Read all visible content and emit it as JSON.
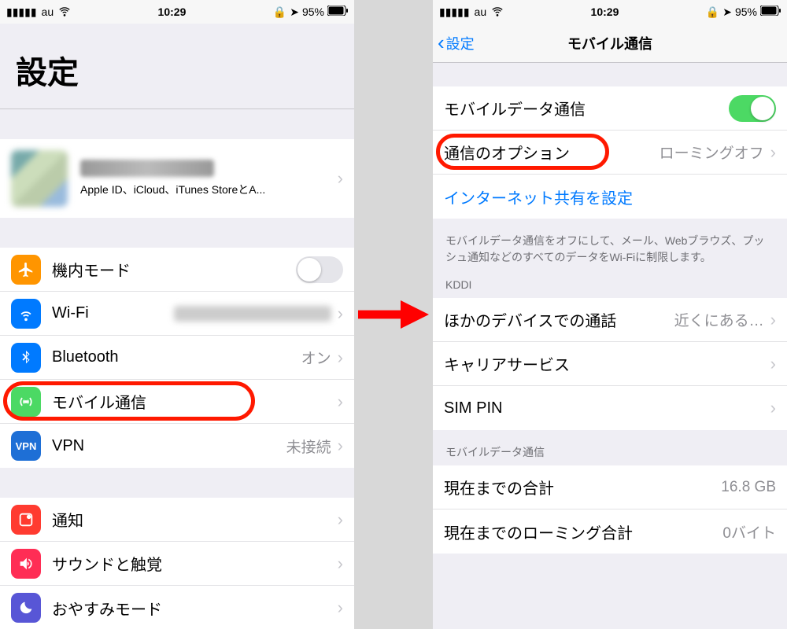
{
  "status": {
    "carrier": "au",
    "time": "10:29",
    "battery": "95%"
  },
  "left": {
    "title": "設定",
    "account_sub": "Apple ID、iCloud、iTunes StoreとA...",
    "rows": {
      "airplane": "機内モード",
      "wifi": "Wi-Fi",
      "bluetooth": "Bluetooth",
      "bt_value": "オン",
      "mobile": "モバイル通信",
      "vpn": "VPN",
      "vpn_value": "未接続",
      "notif": "通知",
      "sound": "サウンドと触覚",
      "dnd": "おやすみモード"
    }
  },
  "right": {
    "back": "設定",
    "title": "モバイル通信",
    "rows": {
      "data": "モバイルデータ通信",
      "options": "通信のオプション",
      "options_value": "ローミングオフ",
      "hotspot": "インターネット共有を設定"
    },
    "footer1": "モバイルデータ通信をオフにして、メール、Webブラウズ、プッシュ通知などのすべてのデータをWi-Fiに制限します。",
    "kddi_header": "KDDI",
    "kddi": {
      "other": "ほかのデバイスでの通話",
      "other_value": "近くにある…",
      "carrier": "キャリアサービス",
      "simpin": "SIM PIN"
    },
    "data_header": "モバイルデータ通信",
    "usage": {
      "total": "現在までの合計",
      "total_value": "16.8 GB",
      "roam": "現在までのローミング合計",
      "roam_value": "0バイト"
    }
  }
}
